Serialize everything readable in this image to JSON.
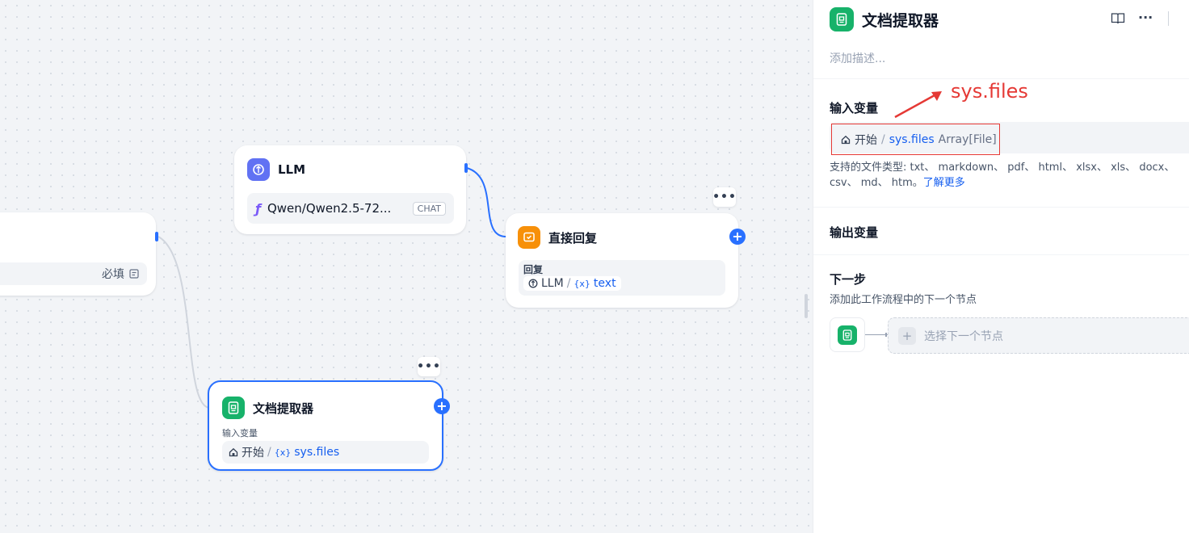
{
  "canvas": {
    "left_node": {
      "required_label": "必填"
    },
    "llm_node": {
      "title": "LLM",
      "model": "Qwen/Qwen2.5-72...",
      "mode": "CHAT"
    },
    "reply_node": {
      "title": "直接回复",
      "field_label": "回复",
      "source_node": "LLM",
      "separator": "/",
      "variable": "text",
      "var_prefix": "{x}"
    },
    "doc_node": {
      "title": "文档提取器",
      "field_label": "输入变量",
      "source_node": "开始",
      "separator": "/",
      "variable": "sys.files",
      "var_prefix": "{x}"
    },
    "more_label": "•••",
    "plus_label": "+"
  },
  "panel": {
    "title": "文档提取器",
    "description_placeholder": "添加描述...",
    "input_section": {
      "title": "输入变量",
      "source_node": "开始",
      "separator": "/",
      "variable": "sys.files",
      "type": "Array[File]",
      "supported_line1": "支持的文件类型: txt、 markdown、 pdf、 html、 xlsx、 xls、 docx、",
      "supported_line2": "csv、 md、 htm。",
      "learn_more": "了解更多"
    },
    "output_section": {
      "title": "输出变量"
    },
    "next_section": {
      "title": "下一步",
      "subtitle": "添加此工作流程中的下一个节点",
      "select_label": "选择下一个节点",
      "plus": "+"
    },
    "toolbar": {
      "more": "···"
    }
  },
  "annotation": {
    "text": "sys.files",
    "color": "#e53935"
  },
  "colors": {
    "accent": "#2970ff",
    "doc_icon": "#17b26a",
    "reply_icon": "#f79009",
    "llm_icon": "#6172f3"
  }
}
